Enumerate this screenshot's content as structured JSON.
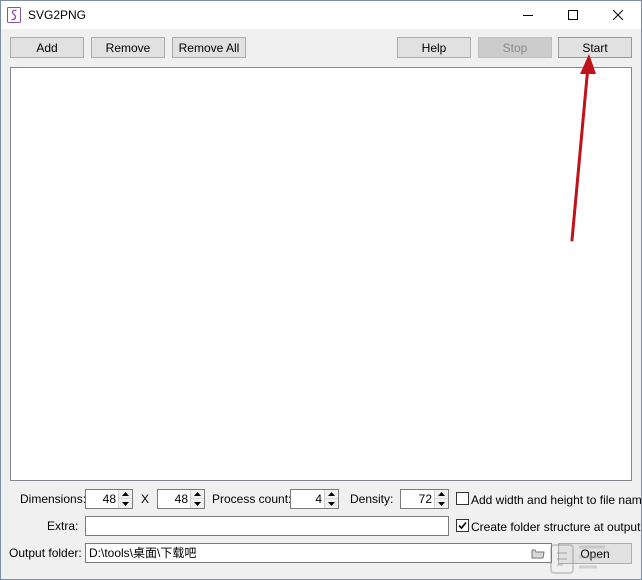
{
  "window": {
    "title": "SVG2PNG"
  },
  "toolbar": {
    "add_label": "Add",
    "remove_label": "Remove",
    "remove_all_label": "Remove All",
    "help_label": "Help",
    "stop_label": "Stop",
    "start_label": "Start"
  },
  "options": {
    "dimensions_label": "Dimensions:",
    "width_value": "48",
    "times_label": "X",
    "height_value": "48",
    "process_count_label": "Process count:",
    "process_count_value": "4",
    "density_label": "Density:",
    "density_value": "72",
    "add_wh_label": "Add width and height to file name",
    "add_wh_checked": false,
    "extra_label": "Extra:",
    "extra_value": "",
    "create_folder_label": "Create folder structure at output",
    "create_folder_checked": true,
    "output_folder_label": "Output folder:",
    "output_folder_value": "D:\\tools\\桌面\\下载吧",
    "open_label": "Open"
  },
  "colors": {
    "annotation_arrow": "#c0121a"
  }
}
